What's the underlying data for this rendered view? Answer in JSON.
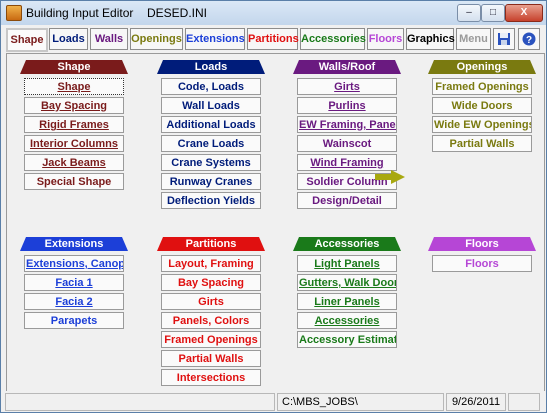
{
  "window": {
    "title": "Building Input Editor",
    "file": "DESED.INI",
    "buttons": {
      "minimize": "–",
      "maximize": "□",
      "close": "X"
    }
  },
  "toolbar": {
    "tabs": [
      {
        "label": "Shape",
        "color": "#7a1b1b"
      },
      {
        "label": "Loads",
        "color": "#001c7a"
      },
      {
        "label": "Walls",
        "color": "#6a1a80"
      },
      {
        "label": "Openings",
        "color": "#7a7a10"
      },
      {
        "label": "Extensions",
        "color": "#1c3fd8"
      },
      {
        "label": "Partitions",
        "color": "#e01010"
      },
      {
        "label": "Accessories",
        "color": "#1a7a1a"
      },
      {
        "label": "Floors",
        "color": "#b646d6"
      },
      {
        "label": "Graphics",
        "color": "#000000"
      },
      {
        "label": "Menu",
        "color": "#9a9a9a"
      }
    ],
    "icons": [
      "save-icon",
      "help-icon"
    ]
  },
  "groups": {
    "shape": {
      "title": "Shape",
      "color": "#7a1b1b",
      "items": [
        "Shape",
        "Bay Spacing",
        "Rigid Frames",
        "Interior Columns",
        "Jack Beams",
        "Special Shape"
      ]
    },
    "loads": {
      "title": "Loads",
      "color": "#001c7a",
      "items": [
        "Code, Loads",
        "Wall Loads",
        "Additional Loads",
        "Crane Loads",
        "Crane Systems",
        "Runway Cranes",
        "Deflection Yields"
      ]
    },
    "walls": {
      "title": "Walls/Roof",
      "color": "#6a1a80",
      "items": [
        "Girts",
        "Purlins",
        "EW Framing, Panels",
        "Wainscot",
        "Wind Framing",
        "Soldier Column",
        "Design/Detail"
      ]
    },
    "openings": {
      "title": "Openings",
      "color": "#7a7a10",
      "items": [
        "Framed Openings",
        "Wide Doors",
        "Wide EW Openings",
        "Partial Walls"
      ]
    },
    "extensions": {
      "title": "Extensions",
      "color": "#1c3fd8",
      "items": [
        "Extensions, Canopies",
        "Facia 1",
        "Facia 2",
        "Parapets"
      ]
    },
    "partitions": {
      "title": "Partitions",
      "color": "#e01010",
      "items": [
        "Layout, Framing",
        "Bay Spacing",
        "Girts",
        "Panels, Colors",
        "Framed Openings",
        "Partial Walls",
        "Intersections"
      ]
    },
    "accessories": {
      "title": "Accessories",
      "color": "#1a7a1a",
      "items": [
        "Light Panels",
        "Gutters, Walk Doors",
        "Liner Panels",
        "Accessories",
        "Accessory Estimates"
      ]
    },
    "floors": {
      "title": "Floors",
      "color": "#b646d6",
      "items": [
        "Floors"
      ]
    }
  },
  "statusbar": {
    "path": "C:\\MBS_JOBS\\",
    "date": "9/26/2011"
  }
}
